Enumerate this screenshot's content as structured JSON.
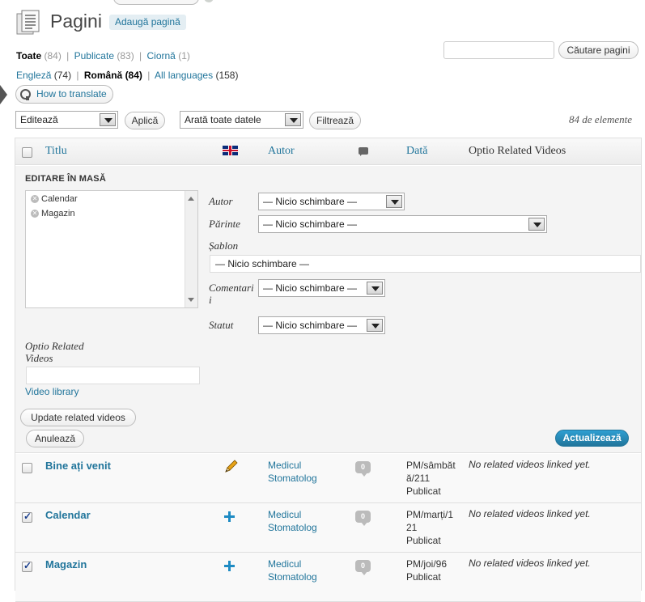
{
  "header": {
    "title": "Pagini",
    "add_button": "Adaugă pagină",
    "search_button": "Căutare pagini",
    "search_value": ""
  },
  "status_filters": [
    {
      "label": "Toate",
      "count": "(84)",
      "current": true
    },
    {
      "label": "Publicate",
      "count": "(83)",
      "current": false
    },
    {
      "label": "Ciornă",
      "count": "(1)",
      "current": false
    }
  ],
  "language_filters": [
    {
      "label": "Engleză",
      "count": "(74)",
      "current": false
    },
    {
      "label": "Română",
      "count": "(84)",
      "current": true
    },
    {
      "label": "All languages",
      "count": "(158)",
      "current": false
    }
  ],
  "how_to_translate": "How to translate",
  "toolbar": {
    "bulk_action_value": "Editează",
    "apply_button": "Aplică",
    "date_filter_value": "Arată toate datele",
    "filter_button": "Filtrează",
    "items_count": "84 de elemente"
  },
  "columns": {
    "title": "Titlu",
    "author": "Autor",
    "date": "Dată",
    "related_videos": "Optio Related Videos"
  },
  "bulk_edit": {
    "heading": "EDITARE ÎN MASĂ",
    "selected_items": [
      "Calendar",
      "Magazin"
    ],
    "fields": {
      "author_label": "Autor",
      "author_value": "— Nicio schimbare —",
      "parent_label": "Părinte",
      "parent_value": "— Nicio schimbare —",
      "template_label": "Șablon",
      "template_value": "— Nicio schimbare —",
      "comments_label_1": "Comentari",
      "comments_label_2": "i",
      "comments_value": "— Nicio schimbare —",
      "status_label": "Statut",
      "status_value": "— Nicio schimbare —"
    },
    "related_videos_label_1": "Optio Related",
    "related_videos_label_2": "Videos",
    "related_videos_value": "",
    "video_library_link": "Video library",
    "update_button": "Update related videos",
    "cancel_button": "Anulează",
    "submit_button": "Actualizează"
  },
  "rows": [
    {
      "checked": false,
      "title": "Bine ați venit",
      "lang_icon": "pencil-icon",
      "author_1": "Medicul",
      "author_2": "Stomatolog",
      "comments": "0",
      "date_1": "PM/sâmbăt",
      "date_2": "ă/211",
      "status": "Publicat",
      "videos": "No related videos linked yet."
    },
    {
      "checked": true,
      "title": "Calendar",
      "lang_icon": "plus-icon",
      "author_1": "Medicul",
      "author_2": "Stomatolog",
      "comments": "0",
      "date_1": "PM/marți/1",
      "date_2": "21",
      "status": "Publicat",
      "videos": "No related videos linked yet."
    },
    {
      "checked": true,
      "title": "Magazin",
      "lang_icon": "plus-icon",
      "author_1": "Medicul",
      "author_2": "Stomatolog",
      "comments": "0",
      "date_1": "PM/joi/96",
      "date_2": "",
      "status": "Publicat",
      "videos": "No related videos linked yet."
    }
  ]
}
